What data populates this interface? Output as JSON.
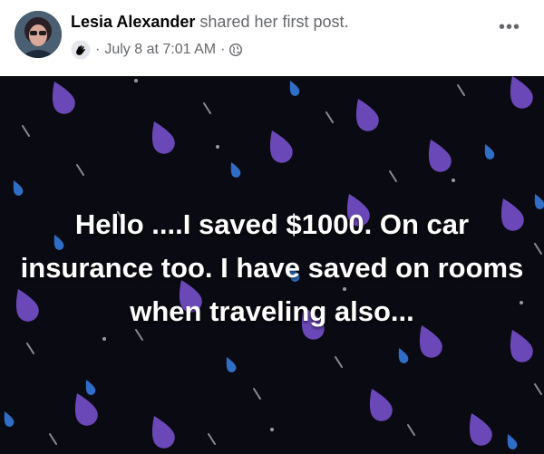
{
  "post": {
    "author_name": "Lesia Alexander",
    "action_text": "shared her first post.",
    "separator": "·",
    "timestamp": "July 8 at 7:01 AM",
    "more_label": "•••",
    "body_text": "Hello ....I saved $1000. On car insurance too. I have saved on rooms when traveling also..."
  },
  "icons": {
    "avatar": "profile-photo",
    "badge": "waving-hand-badge-icon",
    "audience": "globe-icon",
    "more": "more-options-icon"
  },
  "colors": {
    "background": "#0a0a12",
    "drop_purple": "#6b48b8",
    "drop_blue": "#2f6ec6",
    "text": "#ffffff",
    "meta": "#65676b"
  }
}
